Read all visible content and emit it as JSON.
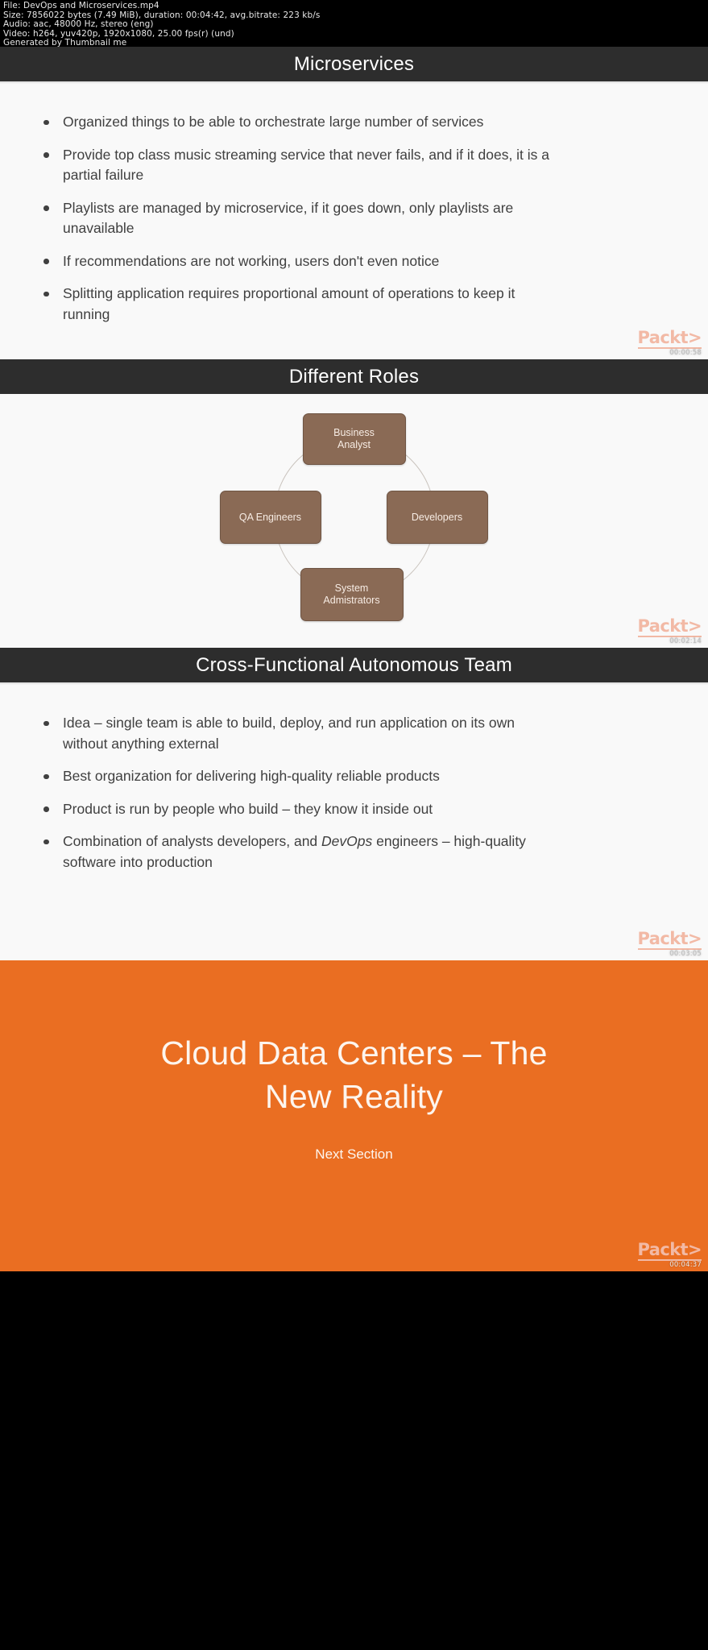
{
  "video_info": {
    "line1": "File: DevOps and Microservices.mp4",
    "line2": "Size: 7856022 bytes (7.49 MiB), duration: 00:04:42, avg.bitrate: 223 kb/s",
    "line3": "Audio: aac, 48000 Hz, stereo (eng)",
    "line4": "Video: h264, yuv420p, 1920x1080, 25.00 fps(r) (und)",
    "line5": "Generated by Thumbnail me"
  },
  "brand": {
    "logo_text": "Packt>",
    "accent_color": "#f2b9a5",
    "orange": "#ea6e22",
    "title_bar_color": "#2d2d2d",
    "box_color": "#8a6a55"
  },
  "slides": [
    {
      "title": "Microservices",
      "timestamp": "00:00:58",
      "bullets": [
        "Organized things to be able to orchestrate large number of services",
        "Provide top class music streaming service that never fails, and if it does, it is a partial failure",
        "Playlists are managed by microservice, if it goes down, only playlists are unavailable",
        "If recommendations are not working, users don't even notice",
        "Splitting application requires proportional amount of operations to keep it running"
      ]
    },
    {
      "title": "Different Roles",
      "timestamp": "00:02:14",
      "diagram": {
        "type": "cycle",
        "roles": [
          {
            "position": "top",
            "label_line1": "Business",
            "label_line2": "Analyst"
          },
          {
            "position": "right",
            "label_line1": "Developers",
            "label_line2": ""
          },
          {
            "position": "bottom",
            "label_line1": "System",
            "label_line2": "Admistrators"
          },
          {
            "position": "left",
            "label_line1": "QA Engineers",
            "label_line2": ""
          }
        ]
      }
    },
    {
      "title": "Cross-Functional Autonomous Team",
      "timestamp": "00:03:05",
      "bullets": [
        "Idea – single team is able to build, deploy, and run application on its own without anything external",
        "Best organization for delivering high-quality reliable products",
        "Product is run by people who build – they know it inside out"
      ],
      "bullet_rich": {
        "prefix": "Combination of analysts  developers, and ",
        "emphasis": "DevOps",
        "suffix": " engineers – high-quality software into production"
      }
    },
    {
      "section_title_line1": "Cloud Data Centers – The",
      "section_title_line2": "New Reality",
      "section_subtitle": "Next Section",
      "timestamp": "00:04:37"
    }
  ]
}
